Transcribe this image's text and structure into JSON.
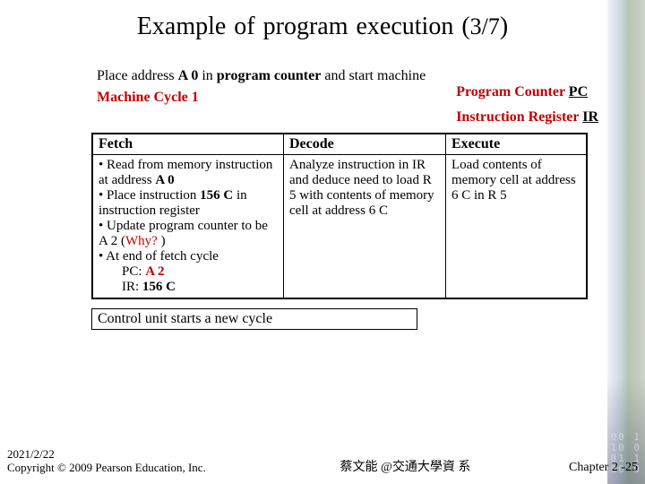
{
  "title_main": "Example of program execution (",
  "title_frac": "3/7",
  "title_close": ")",
  "intro_line1": "Place address ",
  "intro_a0": "A 0",
  "intro_line1b": " in ",
  "intro_pc_word": "program counter",
  "intro_line1c": " and start machine",
  "machine_cycle": "Machine Cycle 1",
  "pc_label": "Program  Counter ",
  "pc_abbr": "PC",
  "ir_label": "Instruction Register ",
  "ir_abbr": "IR",
  "h_fetch": "Fetch",
  "h_decode": "Decode",
  "h_execute": "Execute",
  "fetch_b1a": "• Read  from memory instruction at address ",
  "fetch_b1_a0": "A 0",
  "fetch_b2a": "• Place instruction ",
  "fetch_b2_156c": "156 C",
  "fetch_b2b": " in instruction register",
  "fetch_b3": "• Update program counter to be A 2 (",
  "fetch_why": "Why? ",
  "fetch_b3b": ")",
  "fetch_b4": "• At end of fetch cycle",
  "fetch_pc_line_a": "PC: ",
  "fetch_pc_val": "A 2",
  "fetch_ir_line_a": "IR: ",
  "fetch_ir_val": "156 C",
  "decode_text": "Analyze instruction in IR and deduce need to load R 5 with contents of memory cell at address 6 C",
  "execute_text": "Load contents of memory cell at address 6 C in R 5",
  "control_text": "Control unit starts a new cycle",
  "footer_date": "2021/2/22",
  "footer_copyright": "Copyright © 2009 Pearson Education, Inc.",
  "footer_center": "蔡文能 @交通大學資 系",
  "footer_right": "Chapter 2 -25"
}
